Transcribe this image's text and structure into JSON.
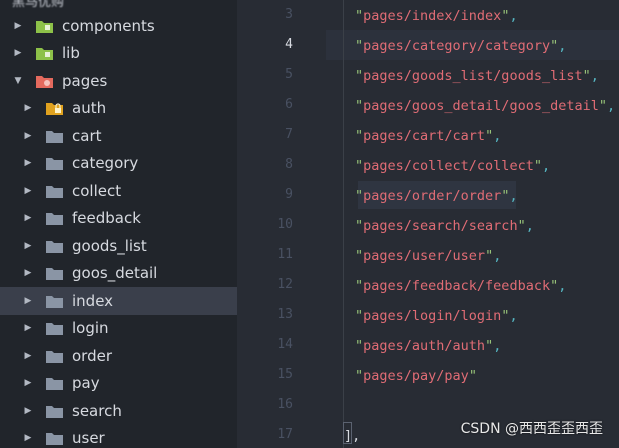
{
  "sidebar": {
    "header": "黑马优购",
    "items": [
      {
        "label": "components",
        "depth": 0,
        "icon": "components-folder-icon",
        "expanded": false
      },
      {
        "label": "lib",
        "depth": 0,
        "icon": "lib-folder-icon",
        "expanded": false
      },
      {
        "label": "pages",
        "depth": 0,
        "icon": "pages-folder-icon",
        "expanded": true
      },
      {
        "label": "auth",
        "depth": 1,
        "icon": "auth-folder-icon",
        "expanded": false
      },
      {
        "label": "cart",
        "depth": 1,
        "icon": "folder-icon",
        "expanded": false
      },
      {
        "label": "category",
        "depth": 1,
        "icon": "folder-icon",
        "expanded": false
      },
      {
        "label": "collect",
        "depth": 1,
        "icon": "folder-icon",
        "expanded": false
      },
      {
        "label": "feedback",
        "depth": 1,
        "icon": "folder-icon",
        "expanded": false
      },
      {
        "label": "goods_list",
        "depth": 1,
        "icon": "folder-icon",
        "expanded": false
      },
      {
        "label": "goos_detail",
        "depth": 1,
        "icon": "folder-icon",
        "expanded": false
      },
      {
        "label": "index",
        "depth": 1,
        "icon": "folder-icon",
        "expanded": false,
        "selected": true
      },
      {
        "label": "login",
        "depth": 1,
        "icon": "folder-icon",
        "expanded": false
      },
      {
        "label": "order",
        "depth": 1,
        "icon": "folder-icon",
        "expanded": false
      },
      {
        "label": "pay",
        "depth": 1,
        "icon": "folder-icon",
        "expanded": false
      },
      {
        "label": "search",
        "depth": 1,
        "icon": "folder-icon",
        "expanded": false
      },
      {
        "label": "user",
        "depth": 1,
        "icon": "folder-icon",
        "expanded": false
      }
    ]
  },
  "editor": {
    "active_line": 4,
    "lines": [
      {
        "num": "3",
        "text": "pages/index/index",
        "trail": ","
      },
      {
        "num": "4",
        "text": "pages/category/category",
        "trail": ","
      },
      {
        "num": "5",
        "text": "pages/goods_list/goods_list",
        "trail": ","
      },
      {
        "num": "6",
        "text": "pages/goos_detail/goos_detail",
        "trail": ","
      },
      {
        "num": "7",
        "text": "pages/cart/cart",
        "trail": ","
      },
      {
        "num": "8",
        "text": "pages/collect/collect",
        "trail": ","
      },
      {
        "num": "9",
        "text": "pages/order/order",
        "trail": ","
      },
      {
        "num": "10",
        "text": "pages/search/search",
        "trail": ","
      },
      {
        "num": "11",
        "text": "pages/user/user",
        "trail": ","
      },
      {
        "num": "12",
        "text": "pages/feedback/feedback",
        "trail": ","
      },
      {
        "num": "13",
        "text": "pages/login/login",
        "trail": ","
      },
      {
        "num": "14",
        "text": "pages/auth/auth",
        "trail": ","
      },
      {
        "num": "15",
        "text": "pages/pay/pay",
        "trail": ""
      },
      {
        "num": "16",
        "text": "",
        "trail": ""
      },
      {
        "num": "17",
        "text": "",
        "trail": "],"
      }
    ]
  },
  "watermark": "CSDN @西西歪歪西歪",
  "colors": {
    "sidebar_bg": "#21252b",
    "editor_bg": "#282c34",
    "string": "#e06c75",
    "quote": "#98c379",
    "comma": "#56b6c2",
    "folder_gray": "#8a95a5",
    "folder_pages": "#e46a5e",
    "folder_lib_components": "#8dc149"
  }
}
